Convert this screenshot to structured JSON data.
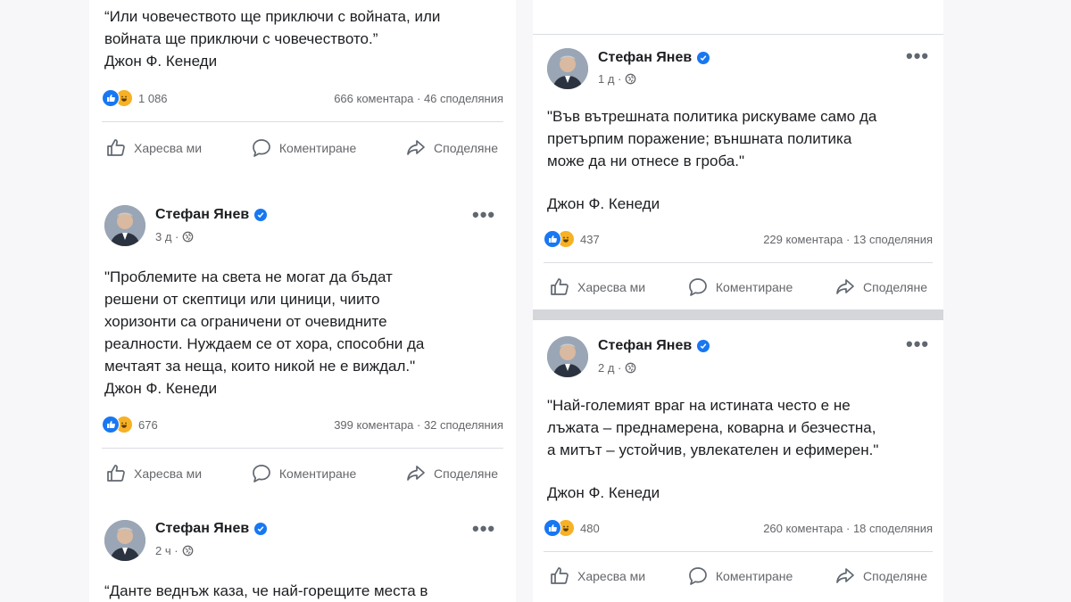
{
  "author": "Стефан Янев",
  "actions": {
    "like": "Харесва ми",
    "comment": "Коментиране",
    "share": "Споделяне"
  },
  "more": "•••",
  "posts": [
    {
      "text": "“Или човечеството ще приключи с войната, или\nвойната ще приключи с човечеството.”\nДжон Ф. Кенеди",
      "reactions": "1 086",
      "comments_shares": "666 коментара · 46 споделяния"
    },
    {
      "time": "3 д ·",
      "text": "\"Проблемите на света не могат да бъдат\nрешени от скептици или циници, чиито\nхоризонти са ограничени от очевидните\nреалности. Нуждаем се от хора, способни да\nмечтаят за неща, които никой не е виждал.\"\nДжон Ф. Кенеди",
      "reactions": "676",
      "comments_shares": "399 коментара · 32 споделяния"
    },
    {
      "time": "2 ч ·",
      "text": "“Данте веднъж каза, че най-горещите места в"
    },
    {
      "time": "1 д ·",
      "text": "\"Във вътрешната политика рискуваме само да\nпретърпим поражение; външната политика\nможе да ни отнесе в гроба.\"",
      "signature": "Джон Ф. Кенеди",
      "reactions": "437",
      "comments_shares": "229 коментара · 13 споделяния"
    },
    {
      "time": "2 д ·",
      "text": "\"Най-големият враг на истината често е не\nлъжата – преднамерена, коварна и безчестна,\nа митът – устойчив, увлекателен и ефимерен.\"",
      "signature": "Джон Ф. Кенеди",
      "reactions": "480",
      "comments_shares": "260 коментара · 18 споделяния"
    }
  ]
}
